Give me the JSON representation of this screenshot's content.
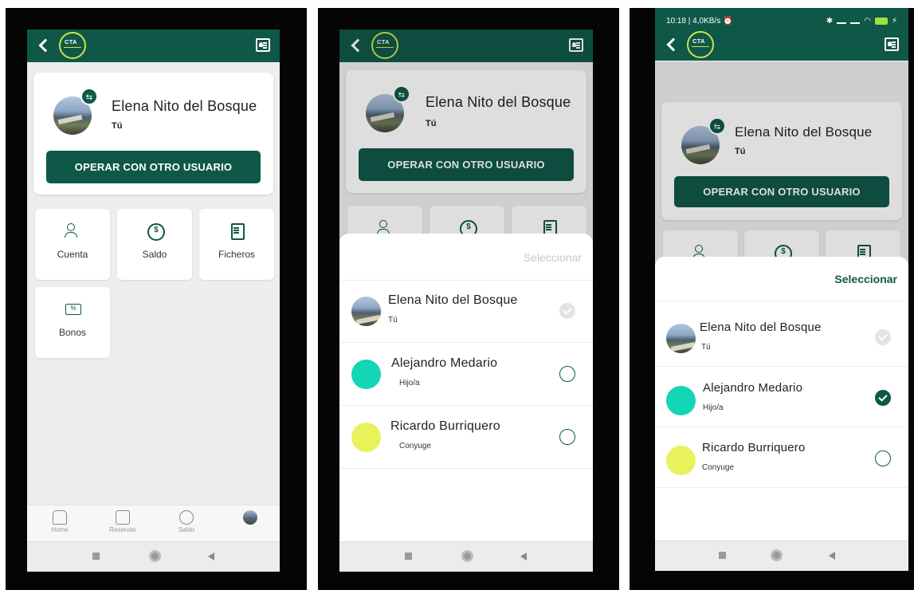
{
  "app": {
    "logo_text": "CTA",
    "colors": {
      "primary": "#0f5848",
      "accent_lime": "#c9e34a",
      "teal_avatar": "#13d6b4",
      "yellow_avatar": "#e9f25a"
    }
  },
  "status_bar": {
    "time_speed": "10:18 | 4,0KB/s",
    "battery": "84"
  },
  "profile": {
    "name": "Elena Nito del Bosque",
    "relation": "Tú",
    "operate_button": "OPERAR CON OTRO USUARIO"
  },
  "tiles": [
    {
      "label": "Cuenta",
      "icon": "user-list-icon"
    },
    {
      "label": "Saldo",
      "icon": "coin-icon"
    },
    {
      "label": "Ficheros",
      "icon": "document-icon"
    },
    {
      "label": "Bonos",
      "icon": "ticket-icon"
    }
  ],
  "bottom_nav": [
    {
      "label": "Home",
      "icon": "home-icon"
    },
    {
      "label": "Reservas",
      "icon": "calendar-icon"
    },
    {
      "label": "Saldo",
      "icon": "coin-icon"
    },
    {
      "label": "",
      "icon": "avatar-icon"
    }
  ],
  "selector": {
    "header": "Seleccionar",
    "users": [
      {
        "name": "Elena Nito del Bosque",
        "relation": "Tú",
        "avatar": "photo"
      },
      {
        "name": "Alejandro Medario",
        "relation": "Hijo/a",
        "avatar": "#13d6b4"
      },
      {
        "name": "Ricardo Burriquero",
        "relation": "Conyuge",
        "avatar": "#e9f25a"
      }
    ]
  }
}
